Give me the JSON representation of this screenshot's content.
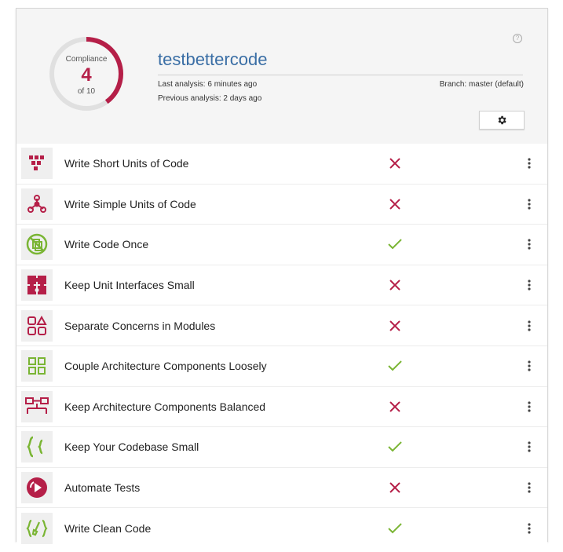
{
  "header": {
    "compliance_label": "Compliance",
    "compliance_value": "4",
    "compliance_total": "of 10",
    "compliance_fraction": 0.4,
    "project_name": "testbettercode",
    "last_analysis": "Last analysis: 6 minutes ago",
    "previous_analysis": "Previous analysis: 2 days ago",
    "branch": "Branch: master (default)",
    "help_icon": "question-circle-icon",
    "settings_icon": "gear-icon"
  },
  "colors": {
    "accent_red": "#b51f48",
    "accent_green": "#7ab534",
    "donut_track": "#e0e0e0",
    "title_blue": "#3a6ea5"
  },
  "guidelines": [
    {
      "label": "Write Short Units of Code",
      "status": "fail",
      "icon": "short-units-icon",
      "color": "red"
    },
    {
      "label": "Write Simple Units of Code",
      "status": "fail",
      "icon": "simple-units-icon",
      "color": "red"
    },
    {
      "label": "Write Code Once",
      "status": "pass",
      "icon": "code-once-icon",
      "color": "green"
    },
    {
      "label": "Keep Unit Interfaces Small",
      "status": "fail",
      "icon": "unit-interfaces-icon",
      "color": "red"
    },
    {
      "label": "Separate Concerns in Modules",
      "status": "fail",
      "icon": "separate-concerns-icon",
      "color": "red"
    },
    {
      "label": "Couple Architecture Components Loosely",
      "status": "pass",
      "icon": "couple-components-icon",
      "color": "green"
    },
    {
      "label": "Keep Architecture Components Balanced",
      "status": "fail",
      "icon": "balanced-components-icon",
      "color": "red"
    },
    {
      "label": "Keep Your Codebase Small",
      "status": "pass",
      "icon": "codebase-small-icon",
      "color": "green"
    },
    {
      "label": "Automate Tests",
      "status": "fail",
      "icon": "automate-tests-icon",
      "color": "red"
    },
    {
      "label": "Write Clean Code",
      "status": "pass",
      "icon": "clean-code-icon",
      "color": "green"
    }
  ]
}
